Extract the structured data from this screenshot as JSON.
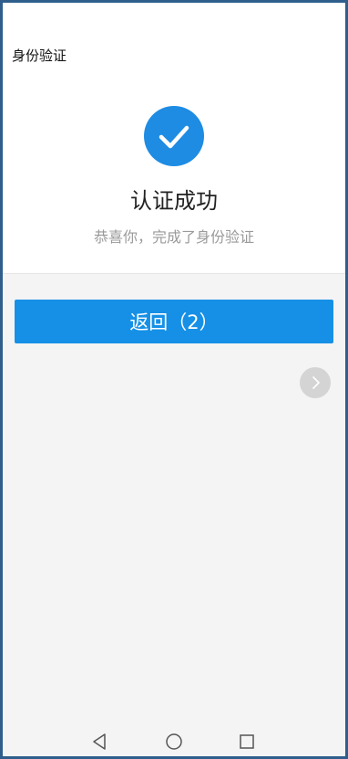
{
  "header": {
    "title": "身份验证"
  },
  "result": {
    "status_icon": "check-circle-icon",
    "title": "认证成功",
    "subtitle": "恭喜你，完成了身份验证"
  },
  "actions": {
    "back_label": "返回（2）"
  },
  "floating": {
    "icon": "chevron-right-icon"
  },
  "system_nav": {
    "back_icon": "triangle-back-icon",
    "home_icon": "circle-home-icon",
    "recents_icon": "square-recents-icon"
  },
  "colors": {
    "accent": "#1690e6",
    "check_circle": "#1e8ce3",
    "frame_border": "#2f5e8c",
    "background": "#f4f4f4",
    "subtitle_text": "#9a9a9a"
  }
}
